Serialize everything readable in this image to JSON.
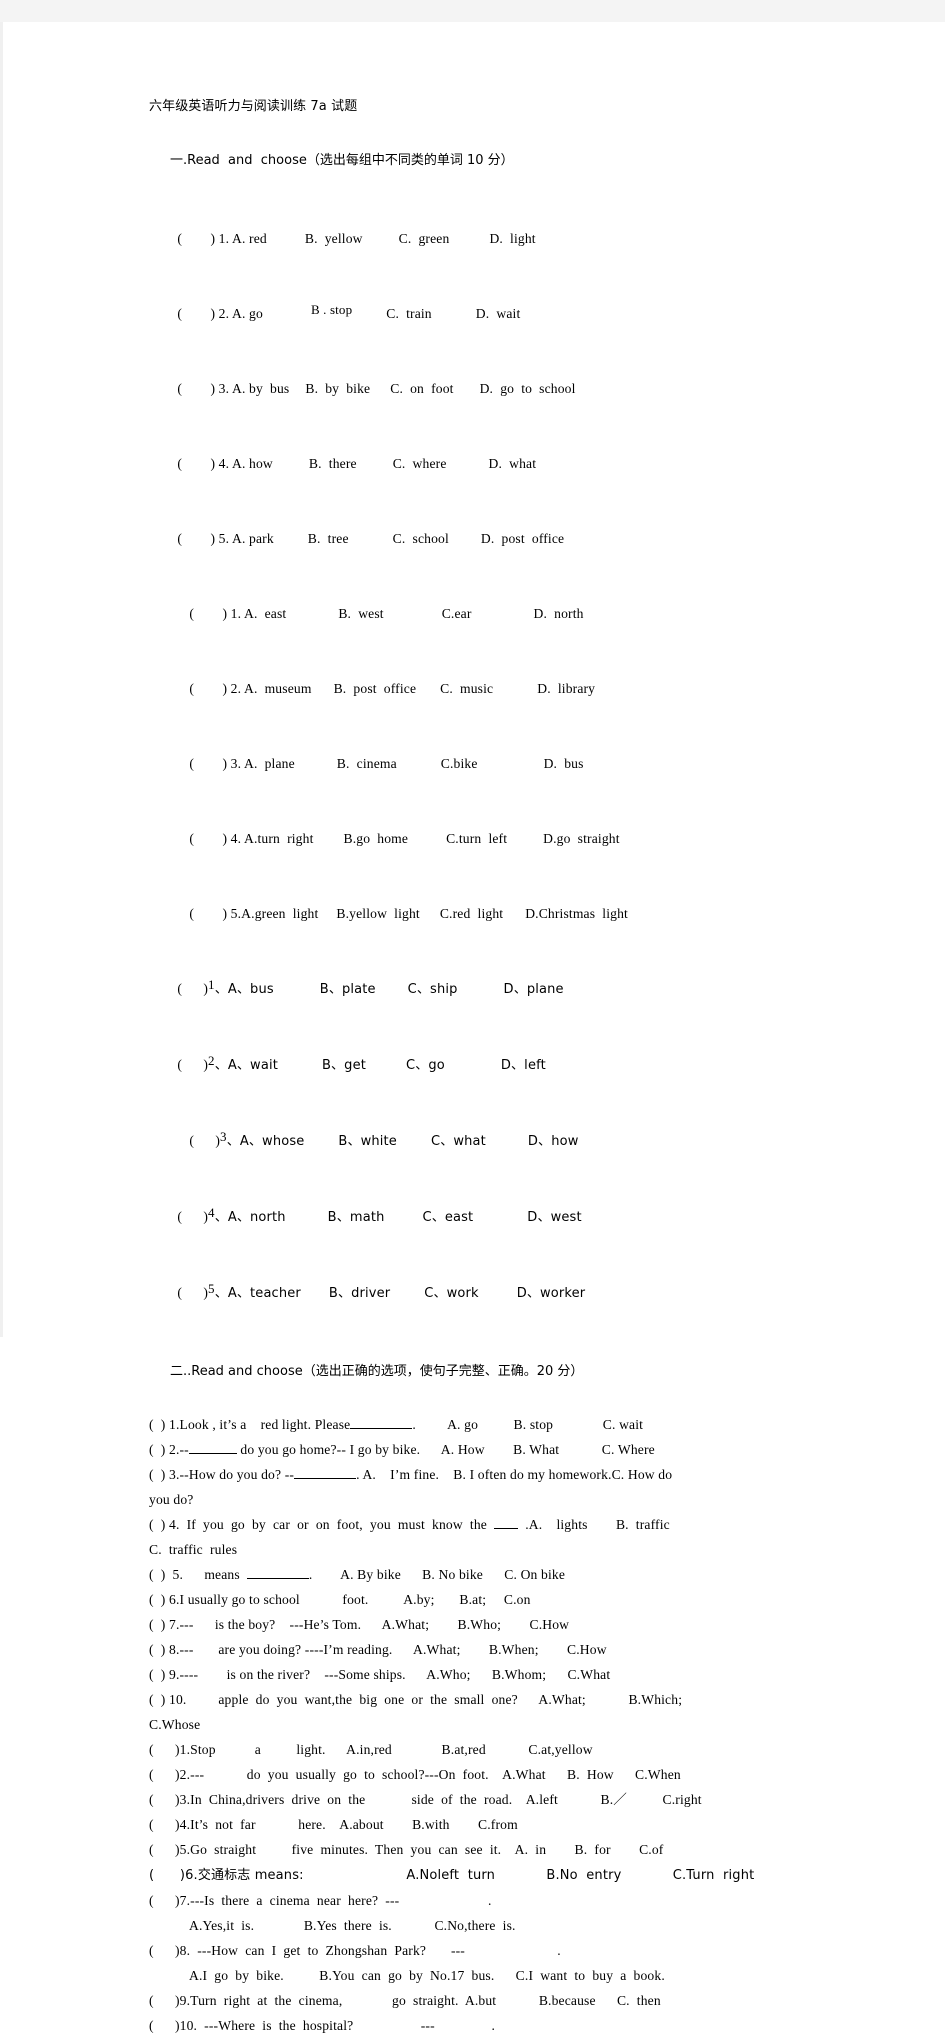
{
  "document": {
    "title": "六年级英语听力与阅读训练 7a 试题"
  },
  "section_one": {
    "heading": "一.Read  and  choose（选出每组中不同类的单词 10 分）",
    "group_a": [
      {
        "mark": "(        ) 1. A. red",
        "b": "B.  yellow",
        "c": "C.  green",
        "d": "D.  light"
      },
      {
        "mark": "(        ) 2. A. go",
        "b": "B . stop",
        "c": "C.  train",
        "d": "D.  wait"
      },
      {
        "mark": "(        ) 3. A. by  bus",
        "b": "B.  by  bike",
        "c": "C.  on  foot",
        "d": "D.  go  to  school"
      },
      {
        "mark": "(        ) 4. A. how",
        "b": "B.  there",
        "c": "C.  where",
        "d": "D.  what"
      },
      {
        "mark": "(        ) 5. A. park",
        "b": "B.  tree",
        "c": "C.  school",
        "d": "D.  post  office"
      }
    ],
    "group_b": [
      {
        "mark": "(        ) 1. A.  east",
        "b": "B.  west",
        "c": "C.ear",
        "d": "D.  north"
      },
      {
        "mark": "(        ) 2. A.  museum",
        "b": "B.  post  office",
        "c": "C.  music",
        "d": "D.  library"
      },
      {
        "mark": "(        ) 3. A.  plane",
        "b": "B.  cinema",
        "c": "C.bike",
        "d": "D.  bus"
      },
      {
        "mark": "(        ) 4. A.turn  right",
        "b": "B.go  home",
        "c": "C.turn  left",
        "d": "D.go  straight"
      },
      {
        "mark": "(        ) 5.A.green  light",
        "b": "B.yellow  light",
        "c": "C.red  light",
        "d": "D.Christmas  light"
      }
    ],
    "group_c": [
      {
        "paren": "(      )",
        "num": "1",
        "a": "、A、bus",
        "b": "B、plate",
        "c": "C、ship",
        "d": "D、plane"
      },
      {
        "paren": "(      )",
        "num": "2",
        "a": "、A、wait",
        "b": "B、get",
        "c": "C、go",
        "d": "D、left"
      },
      {
        "paren": "(      )",
        "num": "3",
        "a": "、A、whose",
        "b": "B、white",
        "c": "C、what",
        "d": "D、how"
      },
      {
        "paren": "(      )",
        "num": "4",
        "a": "、A、north",
        "b": "B、math",
        "c": "C、east",
        "d": "D、west"
      },
      {
        "paren": "(      )",
        "num": "5",
        "a": "、A、teacher",
        "b": "B、driver",
        "c": "C、work",
        "d": "D、worker"
      }
    ]
  },
  "section_two": {
    "heading": "二..Read and choose（选出正确的选项，使句子完整、正确。20 分）",
    "items": [
      {
        "pre": "(  ) 1.Look , it’s a    red light. Please",
        "post": ".         A. go          B. stop              C. wait",
        "blank": "lg"
      },
      {
        "pre": "(  ) 2.--",
        "post": " do you go home?-- I go by bike.      A. How        B. What            C. Where",
        "blank": "md"
      },
      {
        "pre": "(  ) 3.--How do you do? --",
        "post": ". A.    I’m fine.    B. I often do my homework.C. How do",
        "blank": "lg"
      },
      {
        "plain": "you do?"
      },
      {
        "pre": "(  ) 4.  If  you  go  by  car  or  on  foot,  you  must  know  the  ",
        "post": "  .A.    lights        B.  traffic",
        "blank": "sm"
      },
      {
        "plain": "C.  traffic  rules"
      },
      {
        "pre": "(  )  5.      means  ",
        "post": ".        A. By bike      B. No bike      C. On bike",
        "blank": "lg"
      },
      {
        "plain": "(  ) 6.I usually go to school            foot.          A.by;       B.at;     C.on"
      },
      {
        "plain": "(  ) 7.---      is the boy?    ---He’s Tom.      A.What;        B.Who;        C.How"
      },
      {
        "plain": "(  ) 8.---       are you doing? ----I’m reading.      A.What;        B.When;        C.How"
      },
      {
        "plain": "(  ) 9.----        is on the river?    ---Some ships.      A.Who;      B.Whom;      C.What"
      },
      {
        "plain": "(  ) 10.         apple  do  you  want,the  big  one  or  the  small  one?      A.What;            B.Which;"
      },
      {
        "plain": "C.Whose"
      }
    ],
    "items_b": [
      {
        "plain": "(      )1.Stop           a          light.      A.in,red              B.at,red            C.at,yellow"
      },
      {
        "plain": "(      )2.---            do  you  usually  go  to  school?---On  foot.    A.What      B.  How      C.When"
      },
      {
        "plain": "(      )3.In  China,drivers  drive  on  the             side  of  the  road.    A.left            B.／          C.right"
      },
      {
        "plain": "(      )4.It’s  not  far            here.    A.about        B.with        C.from"
      },
      {
        "plain": "(      )5.Go  straight          five  minutes.  Then  you  can  see  it.    A.  in        B.  for        C.of"
      },
      {
        "plain": "(      )6.交通标志 means:                        A.Noleft  turn            B.No  entry            C.Turn  right"
      },
      {
        "plain": ""
      },
      {
        "plain": "(      )7.---Is  there  a  cinema  near  here?  ---                         ."
      },
      {
        "sub": "A.Yes,it  is.              B.Yes  there  is.            C.No,there  is."
      },
      {
        "plain": "(      )8.  ---How  can  I  get  to  Zhongshan  Park?       ---                          ."
      },
      {
        "sub": "A.I  go  by  bike.          B.You  can  go  by  No.17  bus.      C.I  want  to  buy  a  book."
      },
      {
        "plain": "(      )9.Turn  right  at  the  cinema,              go  straight.  A.but            B.because      C.  then"
      },
      {
        "plain": "(      )10.  ---Where  is  the  hospital?                   ---                ."
      }
    ]
  }
}
